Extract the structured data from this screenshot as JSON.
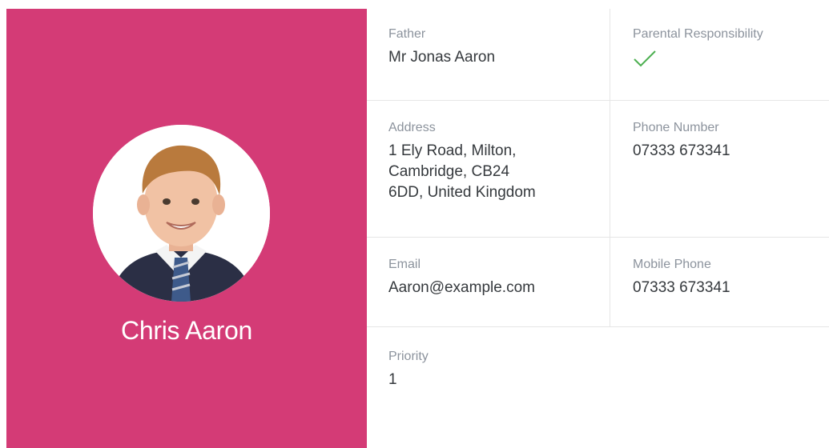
{
  "student": {
    "name": "Chris Aaron",
    "photo_icon": "student-photo"
  },
  "contact": {
    "father_label": "Father",
    "father_value": "Mr Jonas Aaron",
    "parental_label": "Parental Responsibility",
    "parental_icon": "checkmark-icon",
    "address_label": "Address",
    "address_value": "1 Ely Road, Milton,\nCambridge, CB24\n6DD, United Kingdom",
    "phone_label": "Phone Number",
    "phone_value": "07333 673341",
    "email_label": "Email",
    "email_value": "Aaron@example.com",
    "mobile_label": "Mobile Phone",
    "mobile_value": "07333 673341",
    "priority_label": "Priority",
    "priority_value": "1"
  },
  "colors": {
    "panel": "#d43b76",
    "check": "#4caf50"
  }
}
